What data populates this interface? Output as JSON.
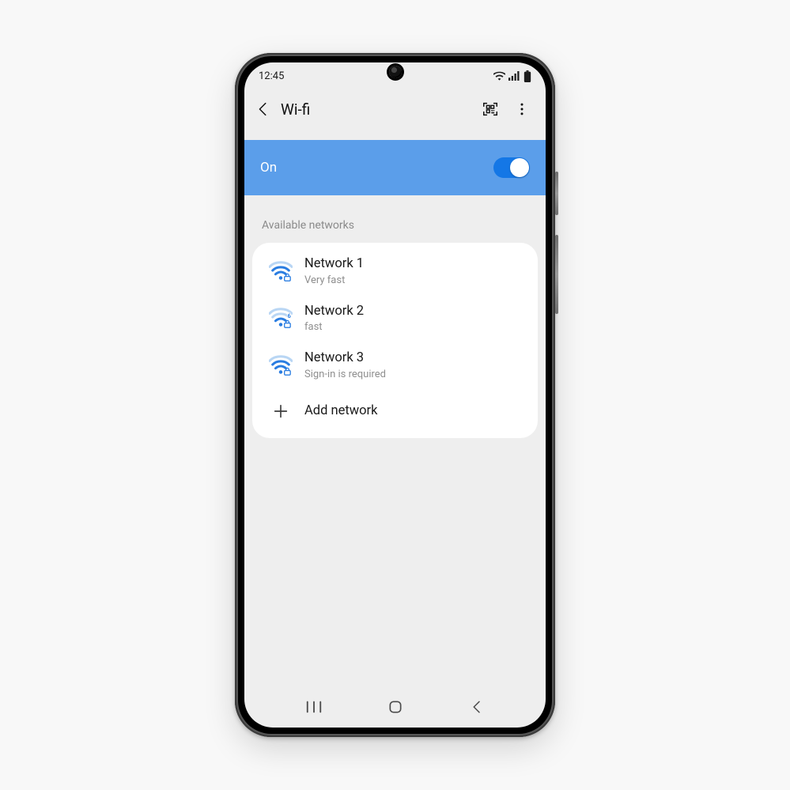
{
  "status": {
    "time": "12:45"
  },
  "appbar": {
    "title": "Wi-fi"
  },
  "toggle": {
    "label": "On",
    "state": true
  },
  "section": {
    "header": "Available networks"
  },
  "networks": [
    {
      "name": "Network 1",
      "sub": "Very fast"
    },
    {
      "name": "Network 2",
      "sub": "fast"
    },
    {
      "name": "Network 3",
      "sub": "Sign-in is required"
    }
  ],
  "add": {
    "label": "Add network"
  },
  "colors": {
    "accent": "#5b9eea",
    "accent_dark": "#1477e6",
    "icon_blue": "#2a7de1",
    "icon_blue_faded": "#b9d6f4",
    "text_muted": "#8f8f8f"
  }
}
